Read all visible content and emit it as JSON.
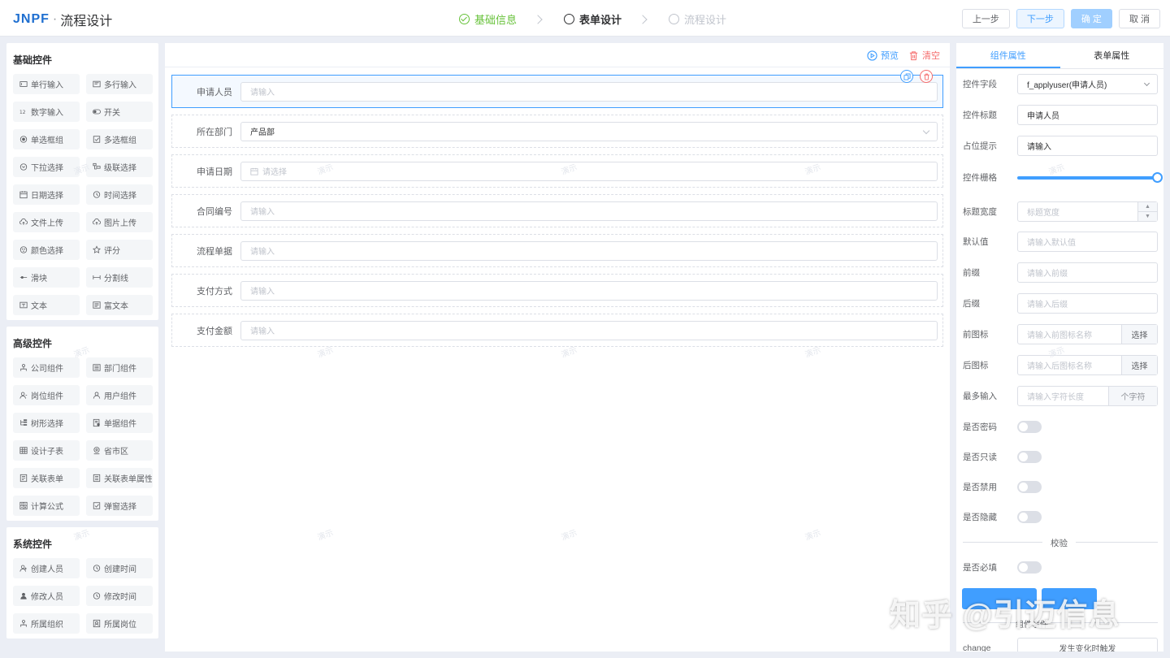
{
  "header": {
    "brand": "JNPF",
    "dot": "·",
    "page_title": "流程设计",
    "steps": [
      {
        "label": "基础信息",
        "state": "done"
      },
      {
        "label": "表单设计",
        "state": "active"
      },
      {
        "label": "流程设计",
        "state": "todo"
      }
    ],
    "buttons": {
      "prev": "上一步",
      "next": "下一步",
      "confirm": "确 定",
      "cancel": "取 消"
    }
  },
  "left": {
    "basic": {
      "title": "基础控件",
      "items": [
        {
          "icon": "input-icon",
          "label": "单行输入"
        },
        {
          "icon": "textarea-icon",
          "label": "多行输入"
        },
        {
          "icon": "number-icon",
          "label": "数字输入"
        },
        {
          "icon": "switch-icon",
          "label": "开关"
        },
        {
          "icon": "radio-icon",
          "label": "单选框组"
        },
        {
          "icon": "checkbox-icon",
          "label": "多选框组"
        },
        {
          "icon": "select-icon",
          "label": "下拉选择"
        },
        {
          "icon": "cascader-icon",
          "label": "级联选择"
        },
        {
          "icon": "date-icon",
          "label": "日期选择"
        },
        {
          "icon": "time-icon",
          "label": "时间选择"
        },
        {
          "icon": "upload-icon",
          "label": "文件上传"
        },
        {
          "icon": "image-upload-icon",
          "label": "图片上传"
        },
        {
          "icon": "color-icon",
          "label": "颜色选择"
        },
        {
          "icon": "star-icon",
          "label": "评分"
        },
        {
          "icon": "slider-icon",
          "label": "滑块"
        },
        {
          "icon": "divider-icon",
          "label": "分割线"
        },
        {
          "icon": "text-icon",
          "label": "文本"
        },
        {
          "icon": "richtext-icon",
          "label": "富文本"
        }
      ]
    },
    "advanced": {
      "title": "高级控件",
      "items": [
        {
          "icon": "company-icon",
          "label": "公司组件"
        },
        {
          "icon": "department-icon",
          "label": "部门组件"
        },
        {
          "icon": "position-icon",
          "label": "岗位组件"
        },
        {
          "icon": "user-icon",
          "label": "用户组件"
        },
        {
          "icon": "tree-icon",
          "label": "树形选择"
        },
        {
          "icon": "bill-icon",
          "label": "单据组件"
        },
        {
          "icon": "table-icon",
          "label": "设计子表"
        },
        {
          "icon": "region-icon",
          "label": "省市区"
        },
        {
          "icon": "related-form-icon",
          "label": "关联表单"
        },
        {
          "icon": "related-attr-icon",
          "label": "关联表单属性"
        },
        {
          "icon": "formula-icon",
          "label": "计算公式"
        },
        {
          "icon": "popup-select-icon",
          "label": "弹窗选择"
        }
      ]
    },
    "system": {
      "title": "系统控件",
      "items": [
        {
          "icon": "creator-icon",
          "label": "创建人员"
        },
        {
          "icon": "clock-icon",
          "label": "创建时间"
        },
        {
          "icon": "modifier-icon",
          "label": "修改人员"
        },
        {
          "icon": "clock-icon",
          "label": "修改时间"
        },
        {
          "icon": "org-icon",
          "label": "所属组织"
        },
        {
          "icon": "post-icon",
          "label": "所属岗位"
        }
      ]
    }
  },
  "canvas": {
    "toolbar": {
      "preview": "预览",
      "clear": "清空"
    },
    "fields": [
      {
        "label": "申请人员",
        "value": "请输入",
        "filled": false,
        "selected": true
      },
      {
        "label": "所在部门",
        "value": "产品部",
        "filled": true,
        "dropdown": true
      },
      {
        "label": "申请日期",
        "value": "请选择",
        "filled": false,
        "date": true
      },
      {
        "label": "合同编号",
        "value": "请输入",
        "filled": false
      },
      {
        "label": "流程单据",
        "value": "请输入",
        "filled": false
      },
      {
        "label": "支付方式",
        "value": "请输入",
        "filled": false
      },
      {
        "label": "支付金额",
        "value": "请输入",
        "filled": false
      }
    ],
    "watermark": "演示"
  },
  "right": {
    "tabs": [
      "组件属性",
      "表单属性"
    ],
    "props": {
      "field": {
        "label": "控件字段",
        "value": "f_applyuser(申请人员)"
      },
      "title": {
        "label": "控件标题",
        "value": "申请人员"
      },
      "placeholder": {
        "label": "占位提示",
        "value": "请输入"
      },
      "span": {
        "label": "控件栅格",
        "value": 1.0
      },
      "label_width": {
        "label": "标题宽度",
        "placeholder": "标题宽度"
      },
      "default": {
        "label": "默认值",
        "placeholder": "请输入默认值"
      },
      "prefix": {
        "label": "前缀",
        "placeholder": "请输入前缀"
      },
      "suffix": {
        "label": "后缀",
        "placeholder": "请输入后缀"
      },
      "prefix_icon": {
        "label": "前图标",
        "placeholder": "请输入前图标名称",
        "button": "选择"
      },
      "suffix_icon": {
        "label": "后图标",
        "placeholder": "请输入后图标名称",
        "button": "选择"
      },
      "maxlength": {
        "label": "最多输入",
        "placeholder": "请输入字符长度",
        "unit": "个字符"
      },
      "password": {
        "label": "是否密码"
      },
      "readonly": {
        "label": "是否只读"
      },
      "disabled": {
        "label": "是否禁用"
      },
      "hidden": {
        "label": "是否隐藏"
      },
      "section": "校验",
      "required": {
        "label": "是否必填"
      },
      "event_title": "组件事件",
      "change": {
        "label": "change",
        "value": "发生变化时触发"
      }
    }
  },
  "overlay_watermark": "知乎 @引迈信息"
}
